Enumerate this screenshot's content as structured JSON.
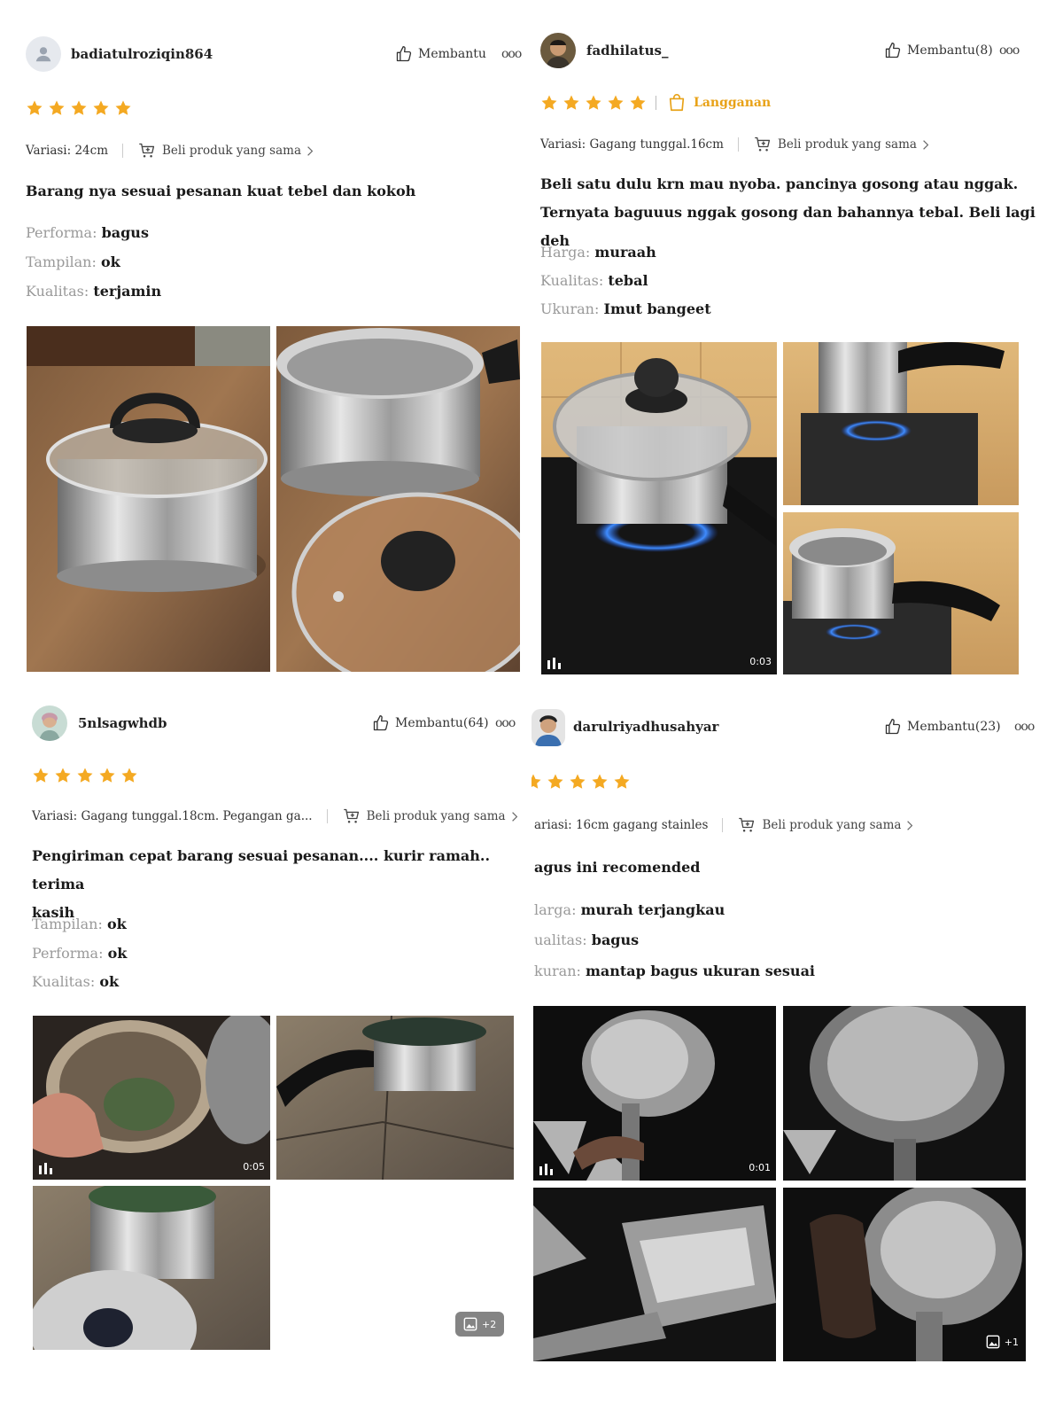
{
  "colors": {
    "star": "#f4a922",
    "accent": "#e8a217",
    "muted_label": "#9a9a9a"
  },
  "reviews": [
    {
      "username": "badiatulroziqin864",
      "helpful_label": "Membantu",
      "stars": 5,
      "variant": "Variasi: 24cm",
      "buy_same": "Beli produk yang sama",
      "comment_lines": [
        "Barang nya sesuai pesanan kuat tebel dan kokoh"
      ],
      "attributes": [
        {
          "key": "Performa:",
          "value": "bagus"
        },
        {
          "key": "Tampilan:",
          "value": "ok"
        },
        {
          "key": "Kualitas:",
          "value": "terjamin"
        }
      ]
    },
    {
      "username": "fadhilatus_",
      "helpful_label": "Membantu(8)",
      "stars": 5,
      "badge": "Langganan",
      "variant": "Variasi: Gagang tunggal.16cm",
      "buy_same": "Beli produk yang sama",
      "comment_lines": [
        "Beli satu dulu krn mau nyoba. pancinya gosong atau nggak.",
        "Ternyata baguuus nggak gosong dan bahannya tebal. Beli lagi deh"
      ],
      "attributes": [
        {
          "key": "Harga:",
          "value": "muraah"
        },
        {
          "key": "Kualitas:",
          "value": "tebal"
        },
        {
          "key": "Ukuran:",
          "value": "Imut bangeet"
        }
      ],
      "video_duration": "0:03"
    },
    {
      "username": "5nlsagwhdb",
      "helpful_label": "Membantu(64)",
      "stars": 5,
      "variant": "Variasi: Gagang tunggal.18cm. Pegangan ga...",
      "buy_same": "Beli produk yang sama",
      "comment_lines": [
        "Pengiriman cepat barang sesuai pesanan.... kurir ramah.. terima",
        "kasih"
      ],
      "attributes": [
        {
          "key": "Tampilan:",
          "value": "ok"
        },
        {
          "key": "Performa:",
          "value": "ok"
        },
        {
          "key": "Kualitas:",
          "value": "ok"
        }
      ],
      "video_duration": "0:05",
      "more_images": "+2"
    },
    {
      "username": "darulriyadhusahyar",
      "helpful_label": "Membantu(23)",
      "stars": 5,
      "variant": "ariasi: 16cm gagang stainles",
      "buy_same": "Beli produk yang sama",
      "comment_lines": [
        "agus ini recomended"
      ],
      "attributes": [
        {
          "key": "larga:",
          "value": "murah terjangkau"
        },
        {
          "key": "ualitas:",
          "value": "bagus"
        },
        {
          "key": "kuran:",
          "value": "mantap bagus ukuran sesuai"
        }
      ],
      "video_duration": "0:01",
      "more_images": "+1"
    }
  ]
}
